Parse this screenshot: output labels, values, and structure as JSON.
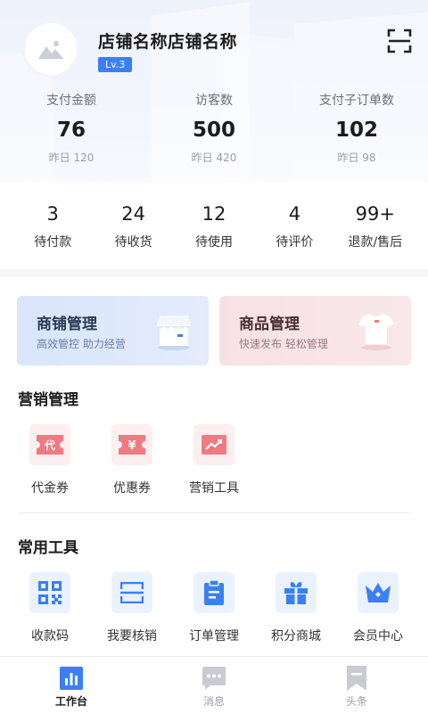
{
  "header": {
    "store_name": "店铺名称店铺名称",
    "level": "Lv.3",
    "avatar_icon": "image-placeholder-icon",
    "scan_icon": "scan-icon",
    "stats": [
      {
        "label": "支付金额",
        "value": "76",
        "sub": "昨日 120"
      },
      {
        "label": "访客数",
        "value": "500",
        "sub": "昨日 420"
      },
      {
        "label": "支付子订单数",
        "value": "102",
        "sub": "昨日 98"
      }
    ]
  },
  "orders": [
    {
      "count": "3",
      "label": "待付款"
    },
    {
      "count": "24",
      "label": "待收货"
    },
    {
      "count": "12",
      "label": "待使用"
    },
    {
      "count": "4",
      "label": "待评价"
    },
    {
      "count": "99+",
      "label": "退款/售后"
    }
  ],
  "cards": {
    "shop": {
      "title": "商铺管理",
      "subtitle": "高效管控 助力经营",
      "icon": "storefront-icon"
    },
    "goods": {
      "title": "商品管理",
      "subtitle": "快速发布 轻松管理",
      "icon": "tshirt-icon"
    }
  },
  "marketing": {
    "title": "营销管理",
    "items": [
      {
        "label": "代金券",
        "icon": "voucher-icon",
        "glyph": "代"
      },
      {
        "label": "优惠券",
        "icon": "coupon-icon",
        "glyph": "¥"
      },
      {
        "label": "营销工具",
        "icon": "trend-chart-icon"
      }
    ]
  },
  "tools": {
    "title": "常用工具",
    "items": [
      {
        "label": "收款码",
        "icon": "qr-code-icon"
      },
      {
        "label": "我要核销",
        "icon": "scan-frame-icon"
      },
      {
        "label": "订单管理",
        "icon": "clipboard-icon"
      },
      {
        "label": "积分商城",
        "icon": "gift-icon"
      },
      {
        "label": "会员中心",
        "icon": "crown-icon"
      }
    ]
  },
  "tabbar": {
    "active": "工作台",
    "items": [
      {
        "label": "工作台",
        "icon": "bar-chart-icon"
      },
      {
        "label": "消息",
        "icon": "message-icon"
      },
      {
        "label": "头条",
        "icon": "bookmark-icon"
      }
    ]
  },
  "colors": {
    "accent_blue": "#3b7ff3",
    "accent_red": "#f07a82",
    "header_bg": "#eef2fb"
  }
}
